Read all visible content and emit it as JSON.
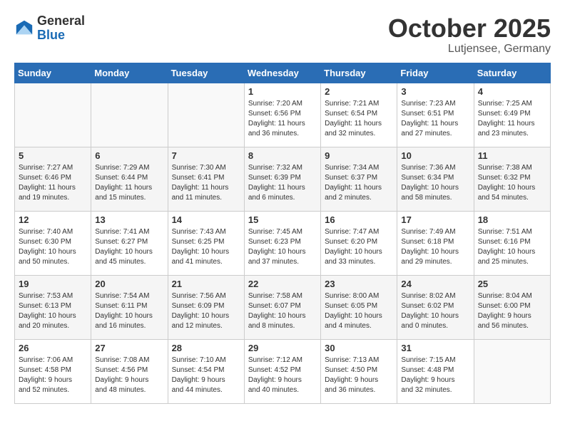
{
  "logo": {
    "general": "General",
    "blue": "Blue"
  },
  "title": "October 2025",
  "location": "Lutjensee, Germany",
  "days_of_week": [
    "Sunday",
    "Monday",
    "Tuesday",
    "Wednesday",
    "Thursday",
    "Friday",
    "Saturday"
  ],
  "weeks": [
    [
      {
        "day": "",
        "info": ""
      },
      {
        "day": "",
        "info": ""
      },
      {
        "day": "",
        "info": ""
      },
      {
        "day": "1",
        "info": "Sunrise: 7:20 AM\nSunset: 6:56 PM\nDaylight: 11 hours\nand 36 minutes."
      },
      {
        "day": "2",
        "info": "Sunrise: 7:21 AM\nSunset: 6:54 PM\nDaylight: 11 hours\nand 32 minutes."
      },
      {
        "day": "3",
        "info": "Sunrise: 7:23 AM\nSunset: 6:51 PM\nDaylight: 11 hours\nand 27 minutes."
      },
      {
        "day": "4",
        "info": "Sunrise: 7:25 AM\nSunset: 6:49 PM\nDaylight: 11 hours\nand 23 minutes."
      }
    ],
    [
      {
        "day": "5",
        "info": "Sunrise: 7:27 AM\nSunset: 6:46 PM\nDaylight: 11 hours\nand 19 minutes."
      },
      {
        "day": "6",
        "info": "Sunrise: 7:29 AM\nSunset: 6:44 PM\nDaylight: 11 hours\nand 15 minutes."
      },
      {
        "day": "7",
        "info": "Sunrise: 7:30 AM\nSunset: 6:41 PM\nDaylight: 11 hours\nand 11 minutes."
      },
      {
        "day": "8",
        "info": "Sunrise: 7:32 AM\nSunset: 6:39 PM\nDaylight: 11 hours\nand 6 minutes."
      },
      {
        "day": "9",
        "info": "Sunrise: 7:34 AM\nSunset: 6:37 PM\nDaylight: 11 hours\nand 2 minutes."
      },
      {
        "day": "10",
        "info": "Sunrise: 7:36 AM\nSunset: 6:34 PM\nDaylight: 10 hours\nand 58 minutes."
      },
      {
        "day": "11",
        "info": "Sunrise: 7:38 AM\nSunset: 6:32 PM\nDaylight: 10 hours\nand 54 minutes."
      }
    ],
    [
      {
        "day": "12",
        "info": "Sunrise: 7:40 AM\nSunset: 6:30 PM\nDaylight: 10 hours\nand 50 minutes."
      },
      {
        "day": "13",
        "info": "Sunrise: 7:41 AM\nSunset: 6:27 PM\nDaylight: 10 hours\nand 45 minutes."
      },
      {
        "day": "14",
        "info": "Sunrise: 7:43 AM\nSunset: 6:25 PM\nDaylight: 10 hours\nand 41 minutes."
      },
      {
        "day": "15",
        "info": "Sunrise: 7:45 AM\nSunset: 6:23 PM\nDaylight: 10 hours\nand 37 minutes."
      },
      {
        "day": "16",
        "info": "Sunrise: 7:47 AM\nSunset: 6:20 PM\nDaylight: 10 hours\nand 33 minutes."
      },
      {
        "day": "17",
        "info": "Sunrise: 7:49 AM\nSunset: 6:18 PM\nDaylight: 10 hours\nand 29 minutes."
      },
      {
        "day": "18",
        "info": "Sunrise: 7:51 AM\nSunset: 6:16 PM\nDaylight: 10 hours\nand 25 minutes."
      }
    ],
    [
      {
        "day": "19",
        "info": "Sunrise: 7:53 AM\nSunset: 6:13 PM\nDaylight: 10 hours\nand 20 minutes."
      },
      {
        "day": "20",
        "info": "Sunrise: 7:54 AM\nSunset: 6:11 PM\nDaylight: 10 hours\nand 16 minutes."
      },
      {
        "day": "21",
        "info": "Sunrise: 7:56 AM\nSunset: 6:09 PM\nDaylight: 10 hours\nand 12 minutes."
      },
      {
        "day": "22",
        "info": "Sunrise: 7:58 AM\nSunset: 6:07 PM\nDaylight: 10 hours\nand 8 minutes."
      },
      {
        "day": "23",
        "info": "Sunrise: 8:00 AM\nSunset: 6:05 PM\nDaylight: 10 hours\nand 4 minutes."
      },
      {
        "day": "24",
        "info": "Sunrise: 8:02 AM\nSunset: 6:02 PM\nDaylight: 10 hours\nand 0 minutes."
      },
      {
        "day": "25",
        "info": "Sunrise: 8:04 AM\nSunset: 6:00 PM\nDaylight: 9 hours\nand 56 minutes."
      }
    ],
    [
      {
        "day": "26",
        "info": "Sunrise: 7:06 AM\nSunset: 4:58 PM\nDaylight: 9 hours\nand 52 minutes."
      },
      {
        "day": "27",
        "info": "Sunrise: 7:08 AM\nSunset: 4:56 PM\nDaylight: 9 hours\nand 48 minutes."
      },
      {
        "day": "28",
        "info": "Sunrise: 7:10 AM\nSunset: 4:54 PM\nDaylight: 9 hours\nand 44 minutes."
      },
      {
        "day": "29",
        "info": "Sunrise: 7:12 AM\nSunset: 4:52 PM\nDaylight: 9 hours\nand 40 minutes."
      },
      {
        "day": "30",
        "info": "Sunrise: 7:13 AM\nSunset: 4:50 PM\nDaylight: 9 hours\nand 36 minutes."
      },
      {
        "day": "31",
        "info": "Sunrise: 7:15 AM\nSunset: 4:48 PM\nDaylight: 9 hours\nand 32 minutes."
      },
      {
        "day": "",
        "info": ""
      }
    ]
  ]
}
